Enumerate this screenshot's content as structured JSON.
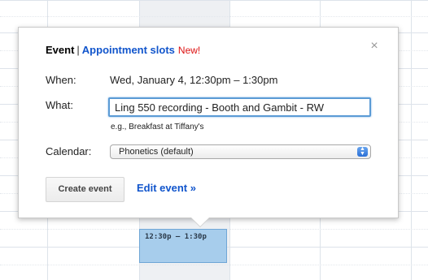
{
  "popup": {
    "tab_event": "Event",
    "tab_separator": "|",
    "tab_appointment": "Appointment slots",
    "new_badge": "New!",
    "close_symbol": "×",
    "when_label": "When:",
    "when_value": "Wed, January 4, 12:30pm – 1:30pm",
    "what_label": "What:",
    "what_value": "Ling 550 recording - Booth and Gambit - RW",
    "what_hint": "e.g., Breakfast at Tiffany's",
    "calendar_label": "Calendar:",
    "calendar_value": "Phonetics (default)",
    "create_button": "Create event",
    "edit_link": "Edit event »"
  },
  "calendar": {
    "event_time": "12:30p – 1:30p"
  },
  "icons": {
    "close": "close-icon",
    "select_arrow": "select-arrows-icon"
  },
  "colors": {
    "link": "#1155cc",
    "new_badge": "#dd1111",
    "event_block": "#a7cdec",
    "input_focus": "#5b9bd5"
  }
}
